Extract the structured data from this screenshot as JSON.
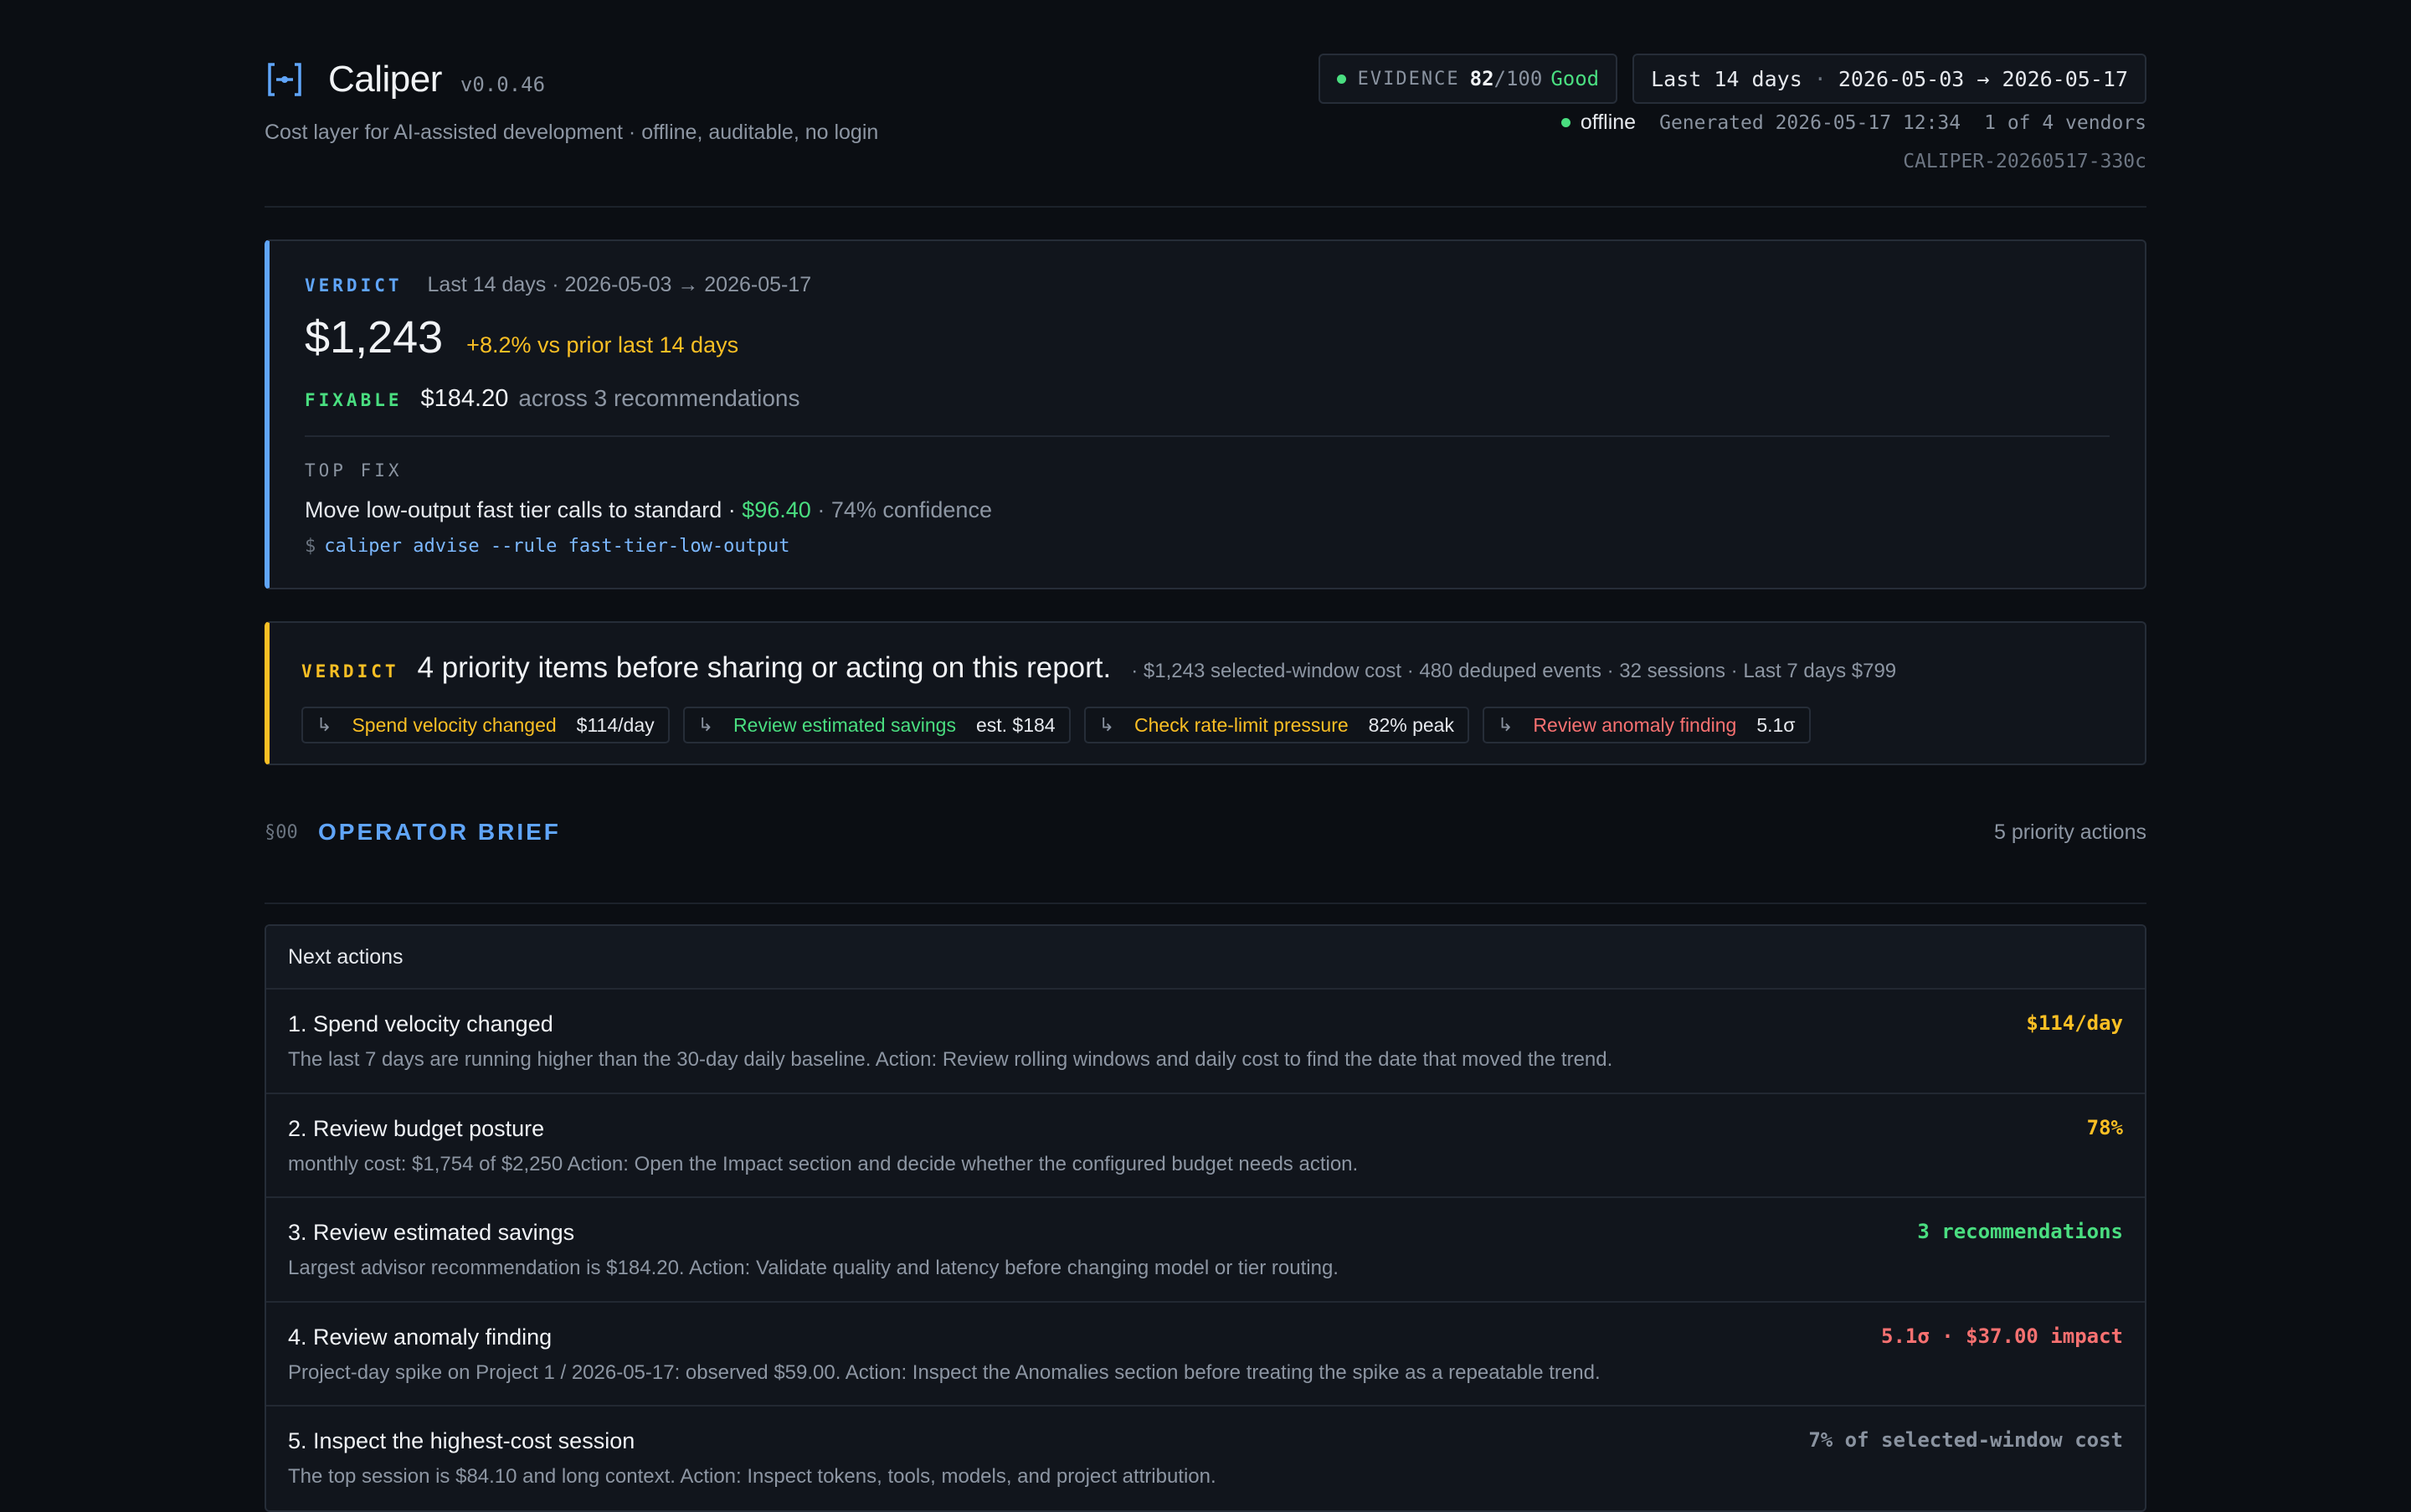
{
  "header": {
    "app_name": "Caliper",
    "version": "v0.0.46",
    "tagline": "Cost layer for AI-assisted development · offline, auditable, no login",
    "evidence": {
      "label": "EVIDENCE",
      "score": "82",
      "max": "/100",
      "grade": "Good"
    },
    "range": {
      "label": "Last 14 days",
      "sep": "·",
      "dates": "2026-05-03 → 2026-05-17"
    },
    "status": "offline",
    "generated": "Generated 2026-05-17 12:34",
    "vendors": "1 of 4 vendors",
    "report_id": "CALIPER-20260517-330c"
  },
  "verdict_card": {
    "label": "VERDICT",
    "period": "Last 14 days · 2026-05-03 → 2026-05-17",
    "amount": "$1,243",
    "delta": "+8.2% vs prior last 14 days",
    "fixable_label": "FIXABLE",
    "fixable_amount": "$184.20",
    "fixable_rest": "across 3 recommendations",
    "top_fix_label": "TOP FIX",
    "top_fix_text": "Move low-output fast tier calls to standard",
    "top_fix_sep1": " · ",
    "top_fix_savings": "$96.40",
    "top_fix_confidence": " · 74% confidence",
    "prompt": "$",
    "command": "caliper advise --rule fast-tier-low-output"
  },
  "priority_card": {
    "label": "VERDICT",
    "headline": "4 priority items before sharing or acting on this report.",
    "meta": "· $1,243 selected-window cost · 480 deduped events · 32 sessions · Last 7 days $799",
    "chips": [
      {
        "arrow": "↳",
        "label": "Spend velocity changed",
        "value": "$114/day",
        "color": "#fbbf24"
      },
      {
        "arrow": "↳",
        "label": "Review estimated savings",
        "value": "est. $184",
        "color": "#4ade80"
      },
      {
        "arrow": "↳",
        "label": "Check rate-limit pressure",
        "value": "82% peak",
        "color": "#fbbf24"
      },
      {
        "arrow": "↳",
        "label": "Review anomaly finding",
        "value": "5.1σ",
        "color": "#f87171"
      }
    ]
  },
  "section": {
    "number": "§00",
    "title": "OPERATOR BRIEF",
    "count": "5 priority actions"
  },
  "actions": {
    "heading": "Next actions",
    "items": [
      {
        "title": "1. Spend velocity changed",
        "desc": "The last 7 days are running higher than the 30-day daily baseline. Action: Review rolling windows and daily cost to find the date that moved the trend.",
        "metric": "$114/day",
        "color": "#fbbf24"
      },
      {
        "title": "2. Review budget posture",
        "desc": "monthly cost: $1,754 of $2,250 Action: Open the Impact section and decide whether the configured budget needs action.",
        "metric": "78%",
        "color": "#fbbf24"
      },
      {
        "title": "3. Review estimated savings",
        "desc": "Largest advisor recommendation is $184.20. Action: Validate quality and latency before changing model or tier routing.",
        "metric": "3 recommendations",
        "color": "#4ade80"
      },
      {
        "title": "4. Review anomaly finding",
        "desc": "Project-day spike on Project 1 / 2026-05-17: observed $59.00. Action: Inspect the Anomalies section before treating the spike as a repeatable trend.",
        "metric": "5.1σ · $37.00 impact",
        "color": "#f87171"
      },
      {
        "title": "5. Inspect the highest-cost session",
        "desc": "The top session is $84.10 and long context. Action: Inspect tokens, tools, models, and project attribution.",
        "metric": "7% of selected-window cost",
        "color": "#8a93a0"
      }
    ]
  },
  "colors": {
    "background": "#0b0e13",
    "accent_blue": "#60a5fa",
    "accent_amber": "#fbbf24",
    "accent_green": "#4ade80",
    "accent_red": "#f87171"
  },
  "icons": {
    "logo": "caliper-logo-icon",
    "status": "status-dot-icon",
    "chip_arrow": "return-arrow-icon"
  }
}
